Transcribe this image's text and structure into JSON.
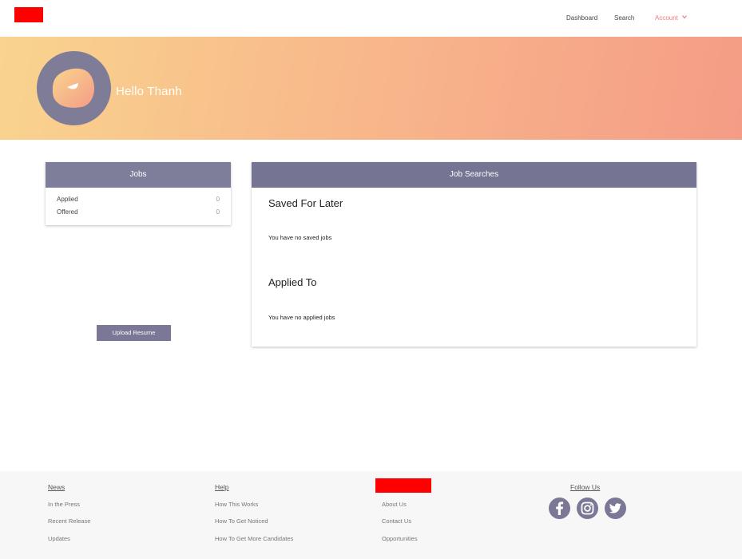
{
  "header": {
    "nav": {
      "dashboard": "Dashboard",
      "search": "Search",
      "account": "Account"
    }
  },
  "banner": {
    "greeting": "Hello Thanh"
  },
  "jobs": {
    "title": "Jobs",
    "rows": [
      {
        "label": "Applied",
        "value": "0"
      },
      {
        "label": "Offered",
        "value": "0"
      }
    ],
    "upload_label": "Upload Resume"
  },
  "job_searches": {
    "title": "Job Searches",
    "saved_title": "Saved For Later",
    "saved_empty": "You have no saved jobs",
    "applied_title": "Applied To",
    "applied_empty": "You have no applied jobs"
  },
  "footer": {
    "news": {
      "heading": "News",
      "links": [
        "In the Press",
        "Recent Release",
        "Updates"
      ]
    },
    "help": {
      "heading": "Help",
      "links": [
        "How This Works",
        "How To Get Noticed",
        "How To Get More Candidates"
      ]
    },
    "company": {
      "links": [
        "About Us",
        "Contact Us",
        "Opportunities"
      ]
    },
    "follow": {
      "heading": "Follow Us",
      "icons": [
        "facebook-icon",
        "instagram-icon",
        "twitter-icon"
      ]
    }
  },
  "colors": {
    "accent": "#f07c7c",
    "card_header": "#7e7e9a",
    "button": "#7a7896",
    "redacted": "#ff0000"
  }
}
